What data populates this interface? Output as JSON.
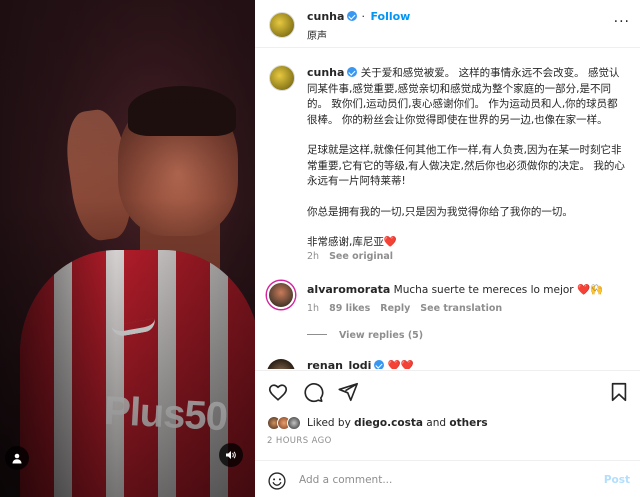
{
  "post": {
    "author": "cunha",
    "follow_label": "Follow",
    "audio_label": "原声",
    "more_label": "···"
  },
  "caption": {
    "author": "cunha",
    "paragraphs": [
      "关于爱和感觉被爱。 这样的事情永远不会改变。 感觉认同某件事,感觉重要,感觉亲切和感觉成为整个家庭的一部分,是不同的。 致你们,运动员们,衷心感谢你们。 作为运动员和人,你的球员都很棒。 你的粉丝会让你觉得即使在世界的另一边,也像在家一样。",
      "足球就是这样,就像任何其他工作一样,有人负责,因为在某一时刻它非常重要,它有它的等级,有人做决定,然后你也必须做你的决定。 我的心永远有一片阿特莱蒂!",
      "你总是拥有我的一切,只是因为我觉得你给了我你的一切。",
      "非常感谢,库尼亚❤️"
    ],
    "time": "2h",
    "see_original": "See original"
  },
  "comments": [
    {
      "author": "alvaromorata",
      "text": "Mucha suerte te mereces lo mejor ❤️🙌",
      "time": "1h",
      "likes": "89 likes",
      "reply": "Reply",
      "translate": "See translation",
      "view_replies": "View replies (5)"
    },
    {
      "author": "renan_lodi",
      "text": "❤️❤️"
    }
  ],
  "likes": {
    "prefix": "Liked by",
    "user": "diego.costa",
    "and": "and",
    "others": "others"
  },
  "timestamp": "2 HOURS AGO",
  "add_comment": {
    "placeholder": "Add a comment...",
    "post_label": "Post"
  },
  "colors": {
    "accent": "#0095f6",
    "verified": "#3897f0",
    "post_disabled": "#b2dffc",
    "muted": "#8e8e8e"
  },
  "icons": [
    "heart-icon",
    "comment-icon",
    "share-icon",
    "bookmark-icon",
    "emoji-icon",
    "sound-icon",
    "user-tag-icon",
    "more-icon",
    "verified-icon"
  ]
}
